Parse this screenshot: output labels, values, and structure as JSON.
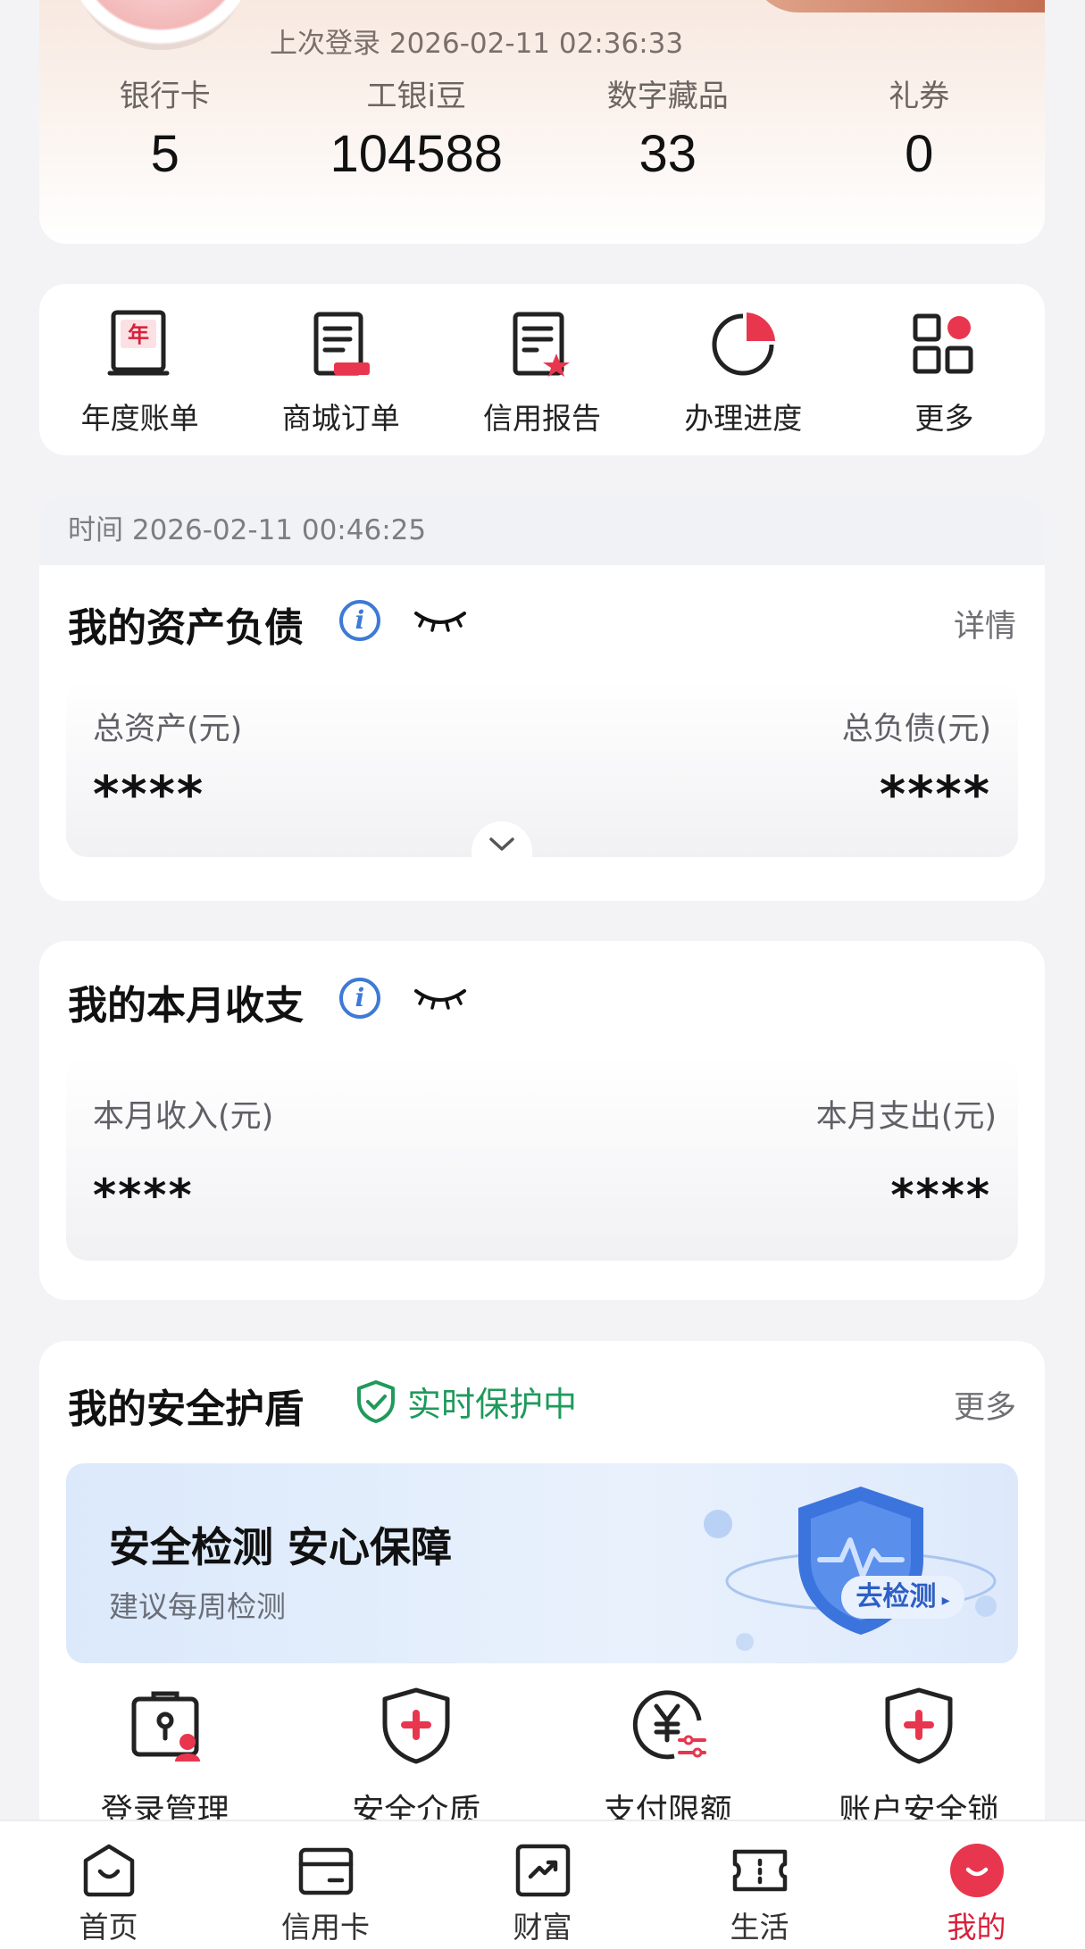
{
  "profile": {
    "last_login": "上次登录 2026-02-11 02:36:33",
    "stats": [
      {
        "label": "银行卡",
        "value": "5"
      },
      {
        "label": "工银i豆",
        "value": "104588"
      },
      {
        "label": "数字藏品",
        "value": "33"
      },
      {
        "label": "礼券",
        "value": "0"
      }
    ]
  },
  "shortcuts": [
    {
      "label": "年度账单",
      "icon": "annual-bill-icon"
    },
    {
      "label": "商城订单",
      "icon": "mall-order-icon"
    },
    {
      "label": "信用报告",
      "icon": "credit-report-icon"
    },
    {
      "label": "办理进度",
      "icon": "progress-icon"
    },
    {
      "label": "更多",
      "icon": "more-grid-icon"
    }
  ],
  "assets": {
    "time": "时间 2026-02-11 00:46:25",
    "title": "我的资产负债",
    "detail": "详情",
    "total_assets_label": "总资产(元)",
    "total_assets_value": "****",
    "total_liabilities_label": "总负债(元)",
    "total_liabilities_value": "****"
  },
  "monthly": {
    "title": "我的本月收支",
    "income_label": "本月收入(元)",
    "income_value": "****",
    "expense_label": "本月支出(元)",
    "expense_value": "****"
  },
  "security": {
    "title": "我的安全护盾",
    "status": "实时保护中",
    "more": "更多",
    "banner_title": "安全检测 安心保障",
    "banner_sub": "建议每周检测",
    "banner_button": "去检测",
    "items": [
      {
        "label": "登录管理"
      },
      {
        "label": "安全介质"
      },
      {
        "label": "支付限额"
      },
      {
        "label": "账户安全锁"
      }
    ]
  },
  "nav": [
    {
      "label": "首页"
    },
    {
      "label": "信用卡"
    },
    {
      "label": "财富"
    },
    {
      "label": "生活"
    },
    {
      "label": "我的",
      "active": true
    }
  ],
  "colors": {
    "accent": "#d8203a",
    "info": "#3d7ad6",
    "safe": "#1f9a5c"
  }
}
